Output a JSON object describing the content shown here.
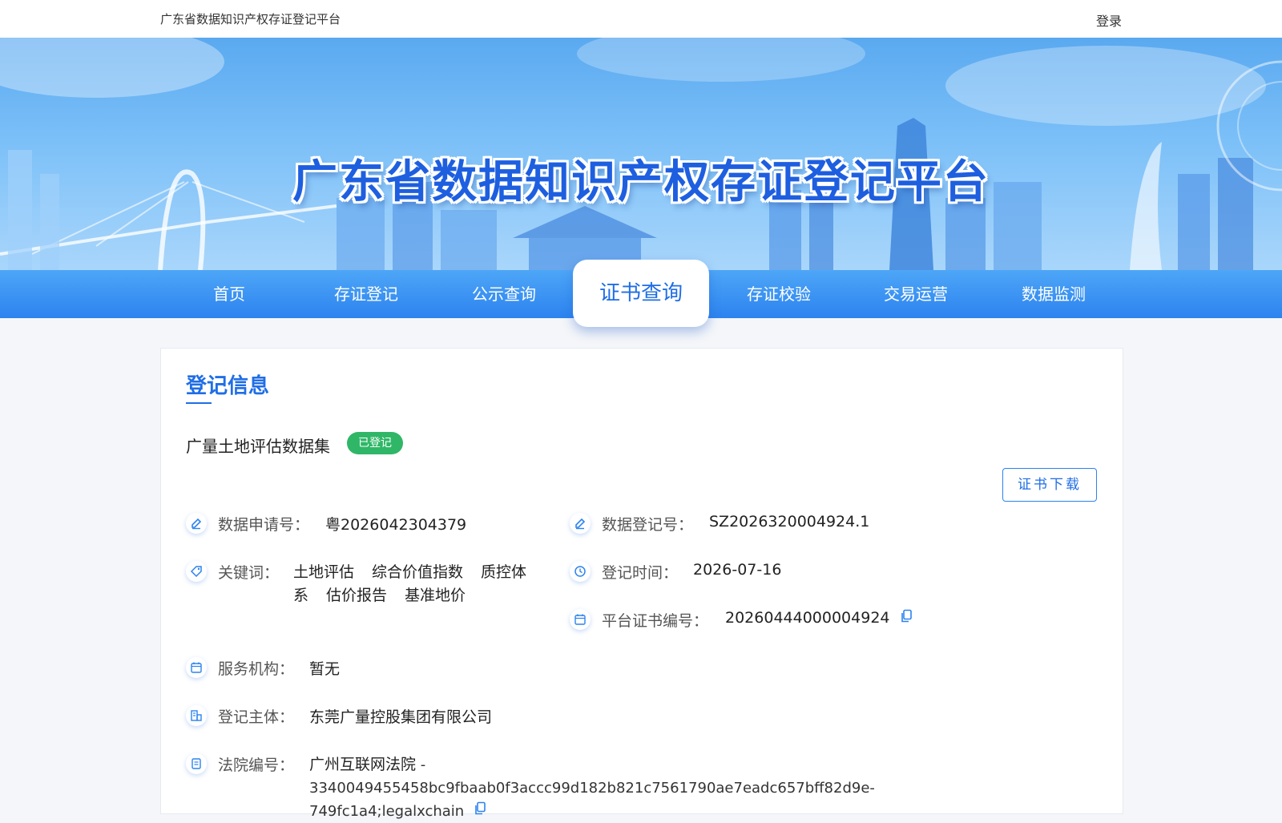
{
  "topbar": {
    "site_title": "广东省数据知识产权存证登记平台",
    "login": "登录"
  },
  "banner": {
    "title": "广东省数据知识产权存证登记平台"
  },
  "nav": {
    "items": [
      "首页",
      "存证登记",
      "公示查询",
      "证书查询",
      "存证校验",
      "交易运营",
      "数据监测"
    ],
    "active_index": 3
  },
  "section": {
    "title": "登记信息"
  },
  "dataset": {
    "name": "广量土地评估数据集",
    "status": "已登记"
  },
  "download_button": "证书下载",
  "fields": {
    "application_no": {
      "label": "数据申请号：",
      "value": "粤2026042304379"
    },
    "registration_no": {
      "label": "数据登记号：",
      "value": "SZ2026320004924.1"
    },
    "keywords": {
      "label": "关键词：",
      "values": [
        "土地评估",
        "综合价值指数",
        "质控体系",
        "估价报告",
        "基准地价"
      ]
    },
    "registration_time": {
      "label": "登记时间：",
      "value": "2026-07-16"
    },
    "certificate_no": {
      "label": "平台证书编号：",
      "value": "20260444000004924"
    },
    "service_agency": {
      "label": "服务机构：",
      "value": "暂无"
    },
    "registrant": {
      "label": "登记主体：",
      "value": "东莞广量控股集团有限公司"
    },
    "court_no": {
      "label": "法院编号：",
      "court": "广州互联网法院",
      "hash": " - 3340049455458bc9fbaab0f3accc99d182b821c7561790ae7eadc657bff82d9e-749fc1a4;legalxchain"
    }
  },
  "colors": {
    "primary": "#1f6ee6",
    "nav_bg": "#2c83ef",
    "badge": "#2fb767"
  }
}
